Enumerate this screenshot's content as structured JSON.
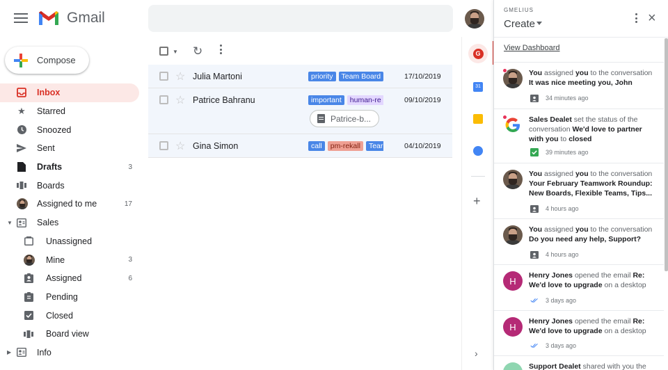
{
  "app": {
    "name": "Gmail"
  },
  "compose": {
    "label": "Compose"
  },
  "nav": [
    {
      "label": "Inbox",
      "icon": "inbox-icon",
      "count": "",
      "active": true
    },
    {
      "label": "Starred",
      "icon": "star-icon",
      "count": ""
    },
    {
      "label": "Snoozed",
      "icon": "clock-icon",
      "count": ""
    },
    {
      "label": "Sent",
      "icon": "send-icon",
      "count": ""
    },
    {
      "label": "Drafts",
      "icon": "draft-icon",
      "count": "3"
    },
    {
      "label": "Boards",
      "icon": "board-icon",
      "count": ""
    },
    {
      "label": "Assigned to me",
      "icon": "avatar-icon",
      "count": "17"
    },
    {
      "label": "Sales",
      "icon": "shared-inbox-icon",
      "count": ""
    },
    {
      "label": "Unassigned",
      "icon": "empty-box-icon",
      "count": ""
    },
    {
      "label": "Mine",
      "icon": "avatar-icon",
      "count": "3"
    },
    {
      "label": "Assigned",
      "icon": "assigned-icon",
      "count": "6"
    },
    {
      "label": "Pending",
      "icon": "pending-icon",
      "count": ""
    },
    {
      "label": "Closed",
      "icon": "closed-icon",
      "count": ""
    },
    {
      "label": "Board view",
      "icon": "board-icon",
      "count": ""
    },
    {
      "label": "Info",
      "icon": "shared-inbox-icon",
      "count": ""
    }
  ],
  "emails": [
    {
      "sender": "Julia Martoni",
      "labels": [
        "priority",
        "Team Board"
      ],
      "date": "17/10/2019"
    },
    {
      "sender": "Patrice Bahranu",
      "labels": [
        "important",
        "human-re"
      ],
      "date": "09/10/2019",
      "attachment": "Patrice-b..."
    },
    {
      "sender": "Gina Simon",
      "labels": [
        "call",
        "pm-rekall",
        "Tear"
      ],
      "date": "04/10/2019"
    }
  ],
  "panel": {
    "brand": "GMELIUS",
    "title": "Create",
    "link": "View Dashboard",
    "activity": [
      {
        "meta": "34 minutes ago"
      },
      {
        "meta": "39 minutes ago"
      },
      {
        "meta": "4 hours ago"
      },
      {
        "meta": "4 hours ago"
      },
      {
        "meta": "3 days ago"
      },
      {
        "meta": "3 days ago"
      }
    ],
    "act": {
      "a0_1": "You",
      "a0_2": " assigned ",
      "a0_3": "you",
      "a0_4": " to the conversation ",
      "a0_5": "It was nice meeting you, John",
      "a1_1": "Sales Dealet",
      "a1_2": " set the status of the conversation ",
      "a1_3": "We'd love to partner with you",
      "a1_4": " to ",
      "a1_5": "closed",
      "a2_1": "You",
      "a2_2": " assigned ",
      "a2_3": "you",
      "a2_4": " to the conversation ",
      "a2_5": "Your February Teamwork Roundup: New Boards, Flexible Teams, Tips...",
      "a3_1": "You",
      "a3_2": " assigned ",
      "a3_3": "you",
      "a3_4": " to the conversation ",
      "a3_5": "Do you need any help, Support?",
      "a4_1": "Henry Jones",
      "a4_2": " opened the email ",
      "a4_3": "Re: We'd love to upgrade",
      "a4_4": " on a desktop",
      "a5_1": "Henry Jones",
      "a5_2": " opened the email ",
      "a5_3": "Re: We'd love to upgrade",
      "a5_4": " on a desktop",
      "a6_1": "Support Dealet",
      "a6_2": " shared with you the"
    },
    "avatar_letters": {
      "h": "H"
    }
  }
}
